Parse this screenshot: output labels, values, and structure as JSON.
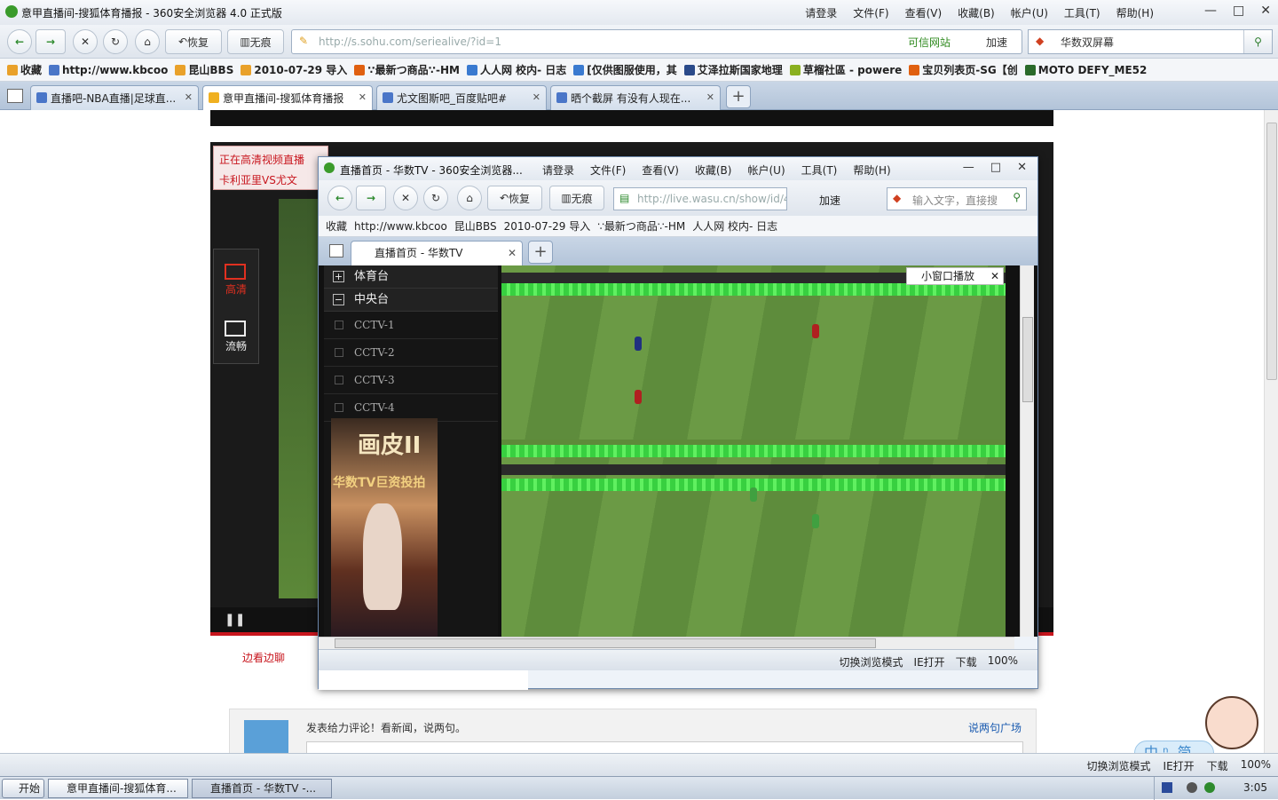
{
  "window": {
    "title": "意甲直播间-搜狐体育播报 - 360安全浏览器 4.0 正式版",
    "menus": [
      "请登录",
      "文件(F)",
      "查看(V)",
      "收藏(B)",
      "帐户(U)",
      "工具(T)",
      "帮助(H)"
    ],
    "controls": [
      "—",
      "□",
      "✕"
    ]
  },
  "toolbar": {
    "restore": "恢复",
    "notrace": "无痕",
    "url": "http://s.sohu.com/seriealive/?id=1",
    "trust": "可信网站",
    "accel": "加速",
    "search_text": "华数双屏幕"
  },
  "favbar": {
    "items": [
      "收藏",
      "http://www.kbcoo",
      "昆山BBS",
      "2010-07-29 导入",
      "∵最新つ商品∵-HM",
      "人人网 校内- 日志",
      "[仅供图服使用，其",
      "艾泽拉斯国家地理",
      "草榴社區 - powere",
      "宝贝列表页-SG【创",
      "MOTO DEFY_ME52"
    ]
  },
  "tabs": [
    {
      "label": "直播吧-NBA直播|足球直..."
    },
    {
      "label": "意甲直播间-搜狐体育播报"
    },
    {
      "label": "尤文图斯吧_百度贴吧#"
    },
    {
      "label": "晒个截屏 有没有人现在..."
    }
  ],
  "page": {
    "banner_line1": "正在高清视频直播",
    "banner_line2": "卡利亚里VS尤文",
    "hd": "高清",
    "smooth": "流畅",
    "pause": "❚❚",
    "bottom_link": "边看边聊",
    "comment_prompt": "发表给力评论！看新闻，说两句。",
    "comment_square": "说两句广场"
  },
  "popup": {
    "title": "直播首页 - 华数TV - 360安全浏览器...",
    "menus": [
      "请登录",
      "文件(F)",
      "查看(V)",
      "收藏(B)",
      "帐户(U)",
      "工具(T)",
      "帮助(H)"
    ],
    "restore": "恢复",
    "notrace": "无痕",
    "url": "http://live.wasu.cn/show/id/4-",
    "accel": "加速",
    "search_placeholder": "输入文字，直接搜",
    "fav": [
      "收藏",
      "http://www.kbcoo",
      "昆山BBS",
      "2010-07-29 导入",
      "∵最新つ商品∵-HM",
      "人人网 校内- 日志"
    ],
    "tab": "直播首页 - 华数TV",
    "channels_header_1": "体育台",
    "channels_header_2": "中央台",
    "channels": [
      "CCTV-1",
      "CCTV-2",
      "CCTV-3",
      "CCTV-4"
    ],
    "ad_title": "画皮II",
    "ad_sub": "华数TV巨资投拍",
    "small_window": "小窗口播放",
    "status": [
      "切换浏览模式",
      "IE打开",
      "下载",
      "100%"
    ]
  },
  "statusbar": {
    "items": [
      "切换浏览模式",
      "IE打开",
      "下载",
      "100%"
    ]
  },
  "taskbar": {
    "start": "开始",
    "task1": "意甲直播间-搜狐体育...",
    "task2": "直播首页 - 华数TV -...",
    "clock": "3:05"
  },
  "mascot": {
    "bubble": "中 ⁿ, 简"
  }
}
